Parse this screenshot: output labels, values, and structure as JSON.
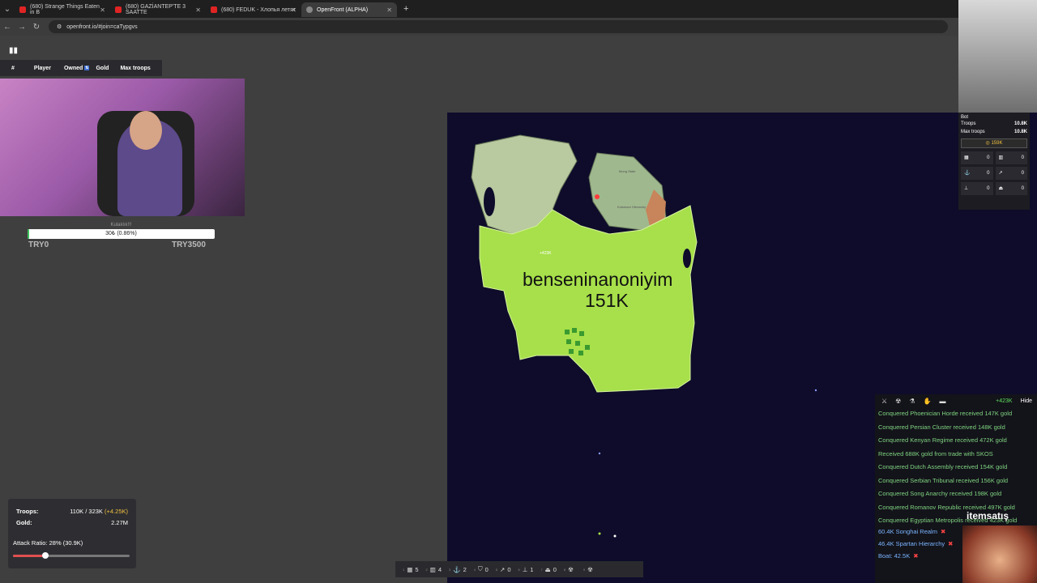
{
  "browser": {
    "tabs": [
      {
        "title": "(680) Strange Things Eaten in B",
        "icon": "youtube-icon",
        "active": false
      },
      {
        "title": "(680) GAZİANTEP'TE 3 SAATTE",
        "icon": "youtube-icon",
        "active": false
      },
      {
        "title": "(680) FEDUK - Хлопья летят",
        "icon": "youtube-icon",
        "active": false
      },
      {
        "title": "OpenFront (ALPHA)",
        "icon": "globe-icon",
        "active": true
      }
    ],
    "url": "openfront.io/#join=caTypgvs"
  },
  "leaderboard": {
    "columns": [
      "#",
      "Player",
      "Owned",
      "Gold",
      "Max troops"
    ]
  },
  "stream_goal": {
    "title": "Kulaklık!!!",
    "progress_text": "30₺ (0.86%)",
    "progress_fraction": 0.0086,
    "min_label": "TRY0",
    "max_label": "TRY3500"
  },
  "map": {
    "player_name": "benseninanoniyim",
    "player_troops": "151K",
    "troop_marker": "+423K",
    "region_labels": [
      "Mong State",
      "Kolsmore Hierarchy"
    ],
    "colors": {
      "ocean": "#0e0c2a",
      "player_land": "#a7e04a"
    }
  },
  "bot_panel": {
    "name": "Bot",
    "troops_label": "Troops",
    "troops_value": "10.8K",
    "max_troops_label": "Max troops",
    "max_troops_value": "10.8K",
    "gold": "159K",
    "buildings": [
      {
        "icon": "city-icon",
        "count": "0"
      },
      {
        "icon": "factory-icon",
        "count": "0"
      },
      {
        "icon": "port-icon",
        "count": "0"
      },
      {
        "icon": "missile-icon",
        "count": "0"
      },
      {
        "icon": "sam-icon",
        "count": "0"
      },
      {
        "icon": "warship-icon",
        "count": "0"
      }
    ]
  },
  "events": {
    "gain": "+423K",
    "hide_label": "Hide",
    "items": [
      "Conquered Phoenician Horde received 147K gold",
      "Conquered Persian Cluster received 148K gold",
      "Conquered Kenyan Regime received 472K gold",
      "Received 688K gold from trade with SKOS",
      "Conquered Dutch Assembly received 154K gold",
      "Conquered Serbian Tribunal received 156K gold",
      "Conquered Song Anarchy received 198K gold",
      "Conquered Romanov Republic received 497K gold",
      "Conquered Egyptian Metropolis received 423K gold"
    ],
    "attacks": [
      {
        "text": "60.4K Songhai Realm"
      },
      {
        "text": "46.4K Spartan Hierarchy"
      },
      {
        "text": "Boat: 42.5K"
      }
    ]
  },
  "watermark": "itemsatış",
  "stats": {
    "troops_label": "Troops:",
    "troops_value": "110K / 323K",
    "troops_gain": "(+4.25K)",
    "gold_label": "Gold:",
    "gold_value": "2.27M",
    "attack_ratio_text": "Attack Ratio: 28% (30.9K)",
    "attack_ratio": 0.28
  },
  "build_bar": [
    {
      "key": "1",
      "icon": "city-icon",
      "count": "5"
    },
    {
      "key": "2",
      "icon": "factory-icon",
      "count": "4"
    },
    {
      "key": "3",
      "icon": "port-icon",
      "count": "2"
    },
    {
      "key": "4",
      "icon": "defense-icon",
      "count": "0"
    },
    {
      "key": "5",
      "icon": "sam-icon",
      "count": "0"
    },
    {
      "key": "6",
      "icon": "missile-silo-icon",
      "count": "1"
    },
    {
      "key": "7",
      "icon": "warship-icon",
      "count": "0"
    },
    {
      "key": "8",
      "icon": "atom-bomb-icon",
      "count": ""
    },
    {
      "key": "9",
      "icon": "hydrogen-bomb-icon",
      "count": ""
    }
  ]
}
